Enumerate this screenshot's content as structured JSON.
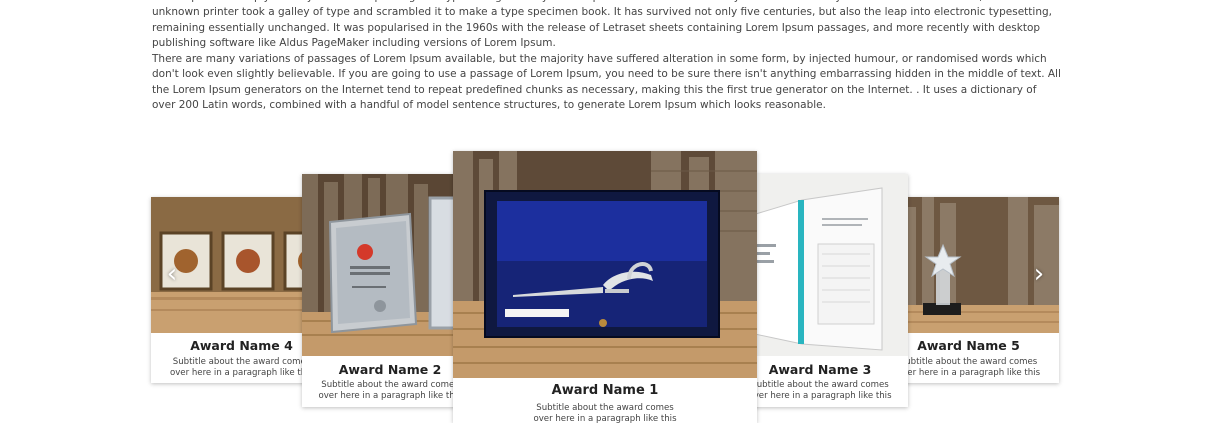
{
  "content": {
    "paragraph_1": "Lorem Ipsum is simply dummy text of the printing and typesetting industry. Lorem Ipsum has been the industry's standard dummy text ever since the 1500s, when an unknown printer took a galley of type and scrambled it to make a type specimen book. It has survived not only five centuries, but also the leap into electronic typesetting, remaining essentially unchanged. It was popularised in the 1960s with the release of Letraset sheets containing Lorem Ipsum passages, and more recently with desktop publishing software like Aldus PageMaker including versions of Lorem Ipsum.",
    "paragraph_2": "There are many variations of passages of Lorem Ipsum available, but the majority have suffered alteration in some form, by injected humour, or randomised words which don't look even slightly believable. If you are going to use a passage of Lorem Ipsum, you need to be sure there isn't anything embarrassing hidden in the middle of text. All the Lorem Ipsum generators on the Internet tend to repeat predefined chunks as necessary, making this the first true generator on the Internet. . It uses a dictionary of over 200 Latin words, combined with a handful of model sentence structures, to generate Lorem Ipsum which looks reasonable."
  },
  "carousel": {
    "prev_icon": "chevron-left-icon",
    "next_icon": "chevron-right-icon",
    "prev_glyph": "‹",
    "next_glyph": "›",
    "cards": {
      "card1": {
        "name": "Award Name 1",
        "subtitle": "Subtitle about the award comes over here in a paragraph like this"
      },
      "card2": {
        "name": "Award Name 2",
        "subtitle": "Subtitle about the award comes over here in a paragraph like this"
      },
      "card3": {
        "name": "Award Name 3",
        "subtitle": "Subtitle about the award comes over here in a paragraph like this"
      },
      "card4": {
        "name": "Award Name 4",
        "subtitle": "Subtitle about the award comes over here in a paragraph like this"
      },
      "card5": {
        "name": "Award Name 5",
        "subtitle": "Subtitle about the award comes over here in a paragraph like this"
      }
    }
  },
  "colors": {
    "background": "#ffffff",
    "body_text": "#444444",
    "title_text": "#222222",
    "box_navy": "#101a44",
    "lining_blue": "#1c2f9e"
  }
}
